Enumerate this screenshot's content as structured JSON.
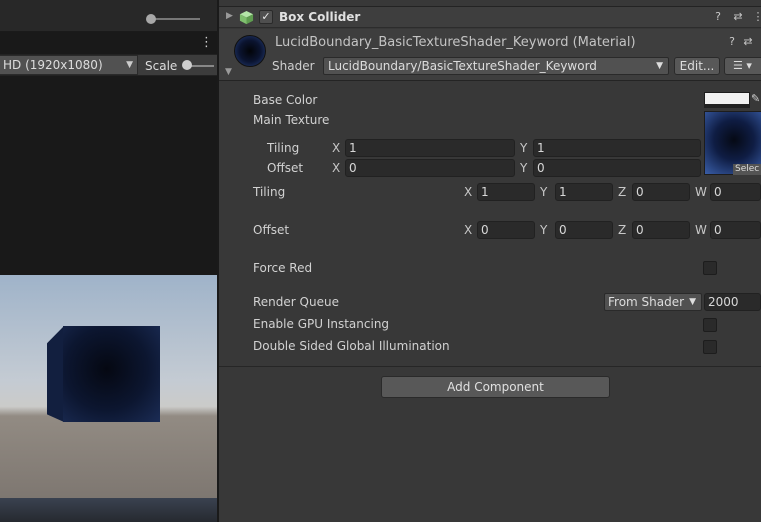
{
  "game_view": {
    "resolution": "HD (1920x1080)",
    "scale_label": "Scale"
  },
  "component": {
    "title": "Box Collider",
    "enabled": true
  },
  "material": {
    "title": "LucidBoundary_BasicTextureShader_Keyword (Material)",
    "shader_label": "Shader",
    "shader_value": "LucidBoundary/BasicTextureShader_Keyword",
    "edit_label": "Edit..."
  },
  "properties": {
    "base_color": "Base Color",
    "main_texture": "Main Texture",
    "texture_select": "Selec",
    "tex_tiling": {
      "label": "Tiling",
      "x": "1",
      "y": "1"
    },
    "tex_offset": {
      "label": "Offset",
      "x": "0",
      "y": "0"
    },
    "tiling": {
      "label": "Tiling",
      "x": "1",
      "y": "1",
      "z": "0",
      "w": "0"
    },
    "offset": {
      "label": "Offset",
      "x": "0",
      "y": "0",
      "z": "0",
      "w": "0"
    },
    "force_red": "Force Red",
    "render_queue": {
      "label": "Render Queue",
      "mode": "From Shader",
      "value": "2000"
    },
    "gpu_instancing": "Enable GPU Instancing",
    "double_sided_gi": "Double Sided Global Illumination"
  },
  "axes": {
    "x": "X",
    "y": "Y",
    "z": "Z",
    "w": "W"
  },
  "add_component": "Add Component"
}
